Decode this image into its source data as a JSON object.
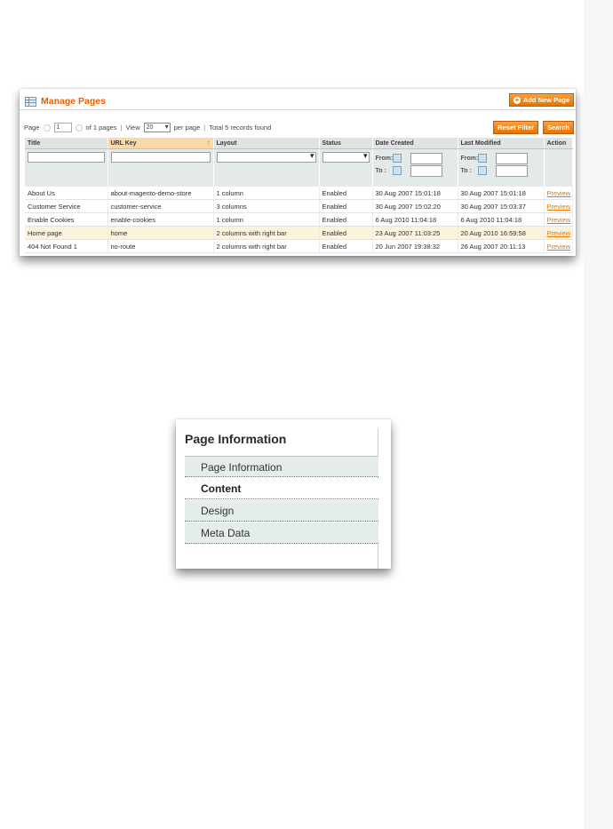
{
  "manage": {
    "title": "Manage Pages",
    "add_new_label": "Add New Page",
    "reset_filter_label": "Reset Filter",
    "search_label": "Search",
    "pager": {
      "page_label": "Page",
      "page_value": "1",
      "of_pages": "of 1 pages",
      "view_label": "View",
      "per_page_value": "20",
      "per_page_label": "per page",
      "total": "Total 5 records found"
    },
    "columns": [
      "Title",
      "URL Key",
      "Layout",
      "Status",
      "Date Created",
      "Last Modified",
      "Action"
    ],
    "date_from_label": "From:",
    "date_to_label": "To :",
    "rows": [
      [
        "About Us",
        "about-magento-demo-store",
        "1 column",
        "Enabled",
        "30 Aug 2007 15:01:18",
        "30 Aug 2007 15:01:18",
        "Preview"
      ],
      [
        "Customer Service",
        "customer-service",
        "3 columns",
        "Enabled",
        "30 Aug 2007 15:02:20",
        "30 Aug 2007 15:03:37",
        "Preview"
      ],
      [
        "Enable Cookies",
        "enable-cookies",
        "1 column",
        "Enabled",
        "6 Aug 2010 11:04:18",
        "6 Aug 2010 11:04:18",
        "Preview"
      ],
      [
        "Home page",
        "home",
        "2 columns with right bar",
        "Enabled",
        "23 Aug 2007 11:03:25",
        "20 Aug 2010 16:59:58",
        "Preview"
      ],
      [
        "404 Not Found 1",
        "no-route",
        "2 columns with right bar",
        "Enabled",
        "20 Jun 2007 19:38:32",
        "26 Aug 2007 20:11:13",
        "Preview"
      ]
    ],
    "highlighted_row": 3,
    "sorted_column": "URL Key",
    "accent_color": "#eb5e00"
  },
  "page_info": {
    "title": "Page Information",
    "tabs": [
      "Page Information",
      "Content",
      "Design",
      "Meta Data"
    ],
    "active_tab": "Content"
  }
}
